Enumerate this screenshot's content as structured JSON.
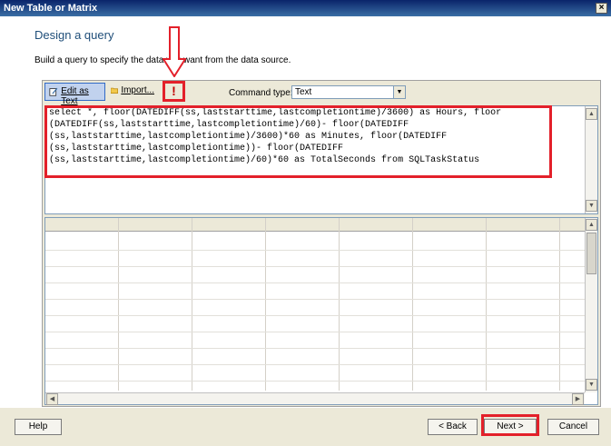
{
  "window": {
    "title": "New Table or Matrix",
    "close_glyph": "×"
  },
  "page": {
    "heading": "Design a query",
    "subtext": "Build a query to specify the data you want from the data source."
  },
  "toolbar": {
    "edit_as_text": "Edit as Text",
    "import": "Import...",
    "run_icon": "!",
    "command_type_label": "Command type:",
    "command_type_value": "Text"
  },
  "query": {
    "sql": "select *, floor(DATEDIFF(ss,laststarttime,lastcompletiontime)/3600) as Hours, floor\n(DATEDIFF(ss,laststarttime,lastcompletiontime)/60)- floor(DATEDIFF\n(ss,laststarttime,lastcompletiontime)/3600)*60 as Minutes, floor(DATEDIFF\n(ss,laststarttime,lastcompletiontime))- floor(DATEDIFF\n(ss,laststarttime,lastcompletiontime)/60)*60 as TotalSeconds from SQLTaskStatus"
  },
  "footer": {
    "help": "Help",
    "back": "< Back",
    "next": "Next >",
    "cancel": "Cancel"
  },
  "colors": {
    "annotation_red": "#e3202a",
    "heading_blue": "#1f4e79"
  },
  "icons": [
    "edit-as-text-icon",
    "import-folder-icon",
    "run-exclamation-icon",
    "down-arrow-annotation-icon"
  ]
}
